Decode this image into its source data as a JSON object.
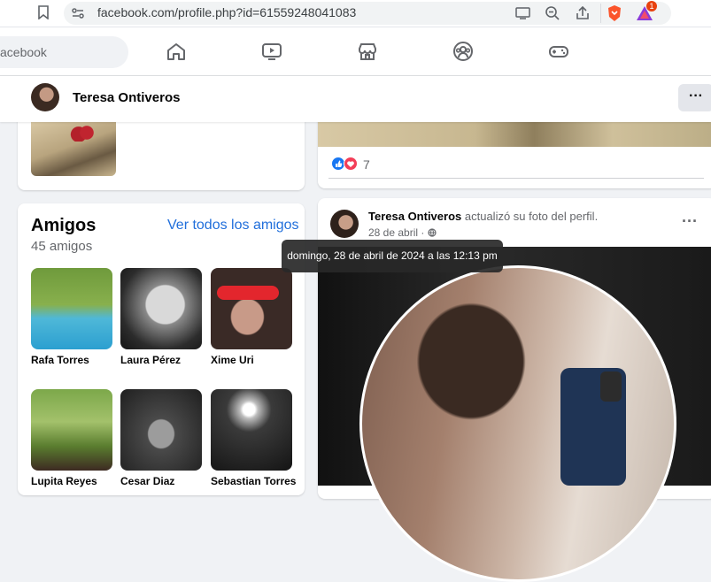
{
  "browser": {
    "url": "facebook.com/profile.php?id=61559248041083",
    "brave_badge": "1"
  },
  "nav": {
    "search_text": "acebook",
    "icons": [
      "home-icon",
      "video-icon",
      "marketplace-icon",
      "groups-icon",
      "gaming-icon"
    ]
  },
  "profile_bar": {
    "name": "Teresa Ontiveros",
    "more": "···"
  },
  "reactions": {
    "count": "7",
    "colors": {
      "like": "#1877f2",
      "love": "#f33e58"
    }
  },
  "friends": {
    "title": "Amigos",
    "see_all": "Ver todos los amigos",
    "count": "45 amigos",
    "list": [
      {
        "name": "Rafa Torres"
      },
      {
        "name": "Laura Pérez"
      },
      {
        "name": "Xime Uri"
      },
      {
        "name": "Lupita Reyes"
      },
      {
        "name": "Cesar Diaz"
      },
      {
        "name": "Sebastian Torres"
      }
    ]
  },
  "post": {
    "author": "Teresa Ontiveros",
    "action": " actualizó su foto del perfil.",
    "date": "28 de abril",
    "more": "···",
    "tooltip": "domingo, 28 de abril de 2024 a las 12:13 pm"
  }
}
